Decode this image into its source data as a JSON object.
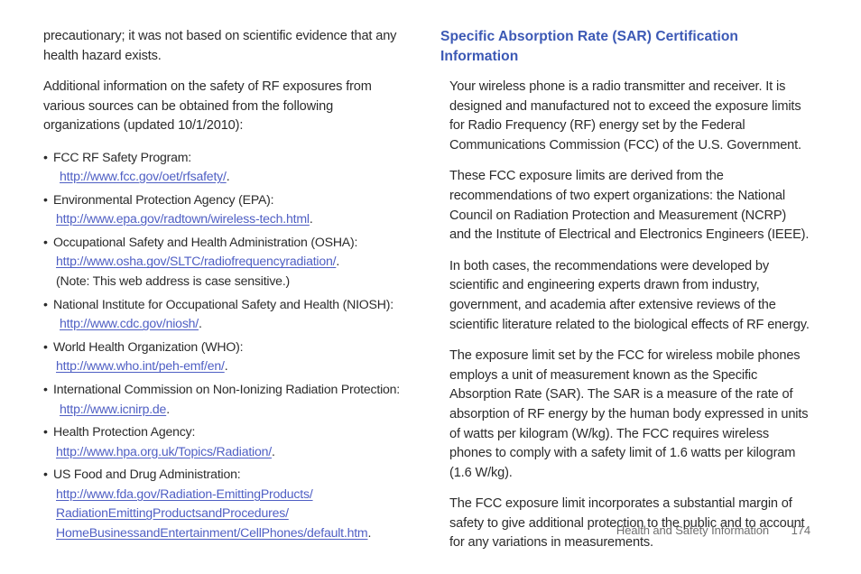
{
  "document": {
    "left_column": {
      "paragraphs": [
        "precautionary; it was not based on scientific evidence that any health hazard exists.",
        "Additional information on the safety of RF exposures from various sources can be obtained from the following organizations (updated 10/1/2010):"
      ],
      "bullet_marker": "•",
      "organizations": [
        {
          "label": "FCC RF Safety Program:",
          "url": "http://www.fcc.gov/oet/rfsafety/",
          "url_extra_indent": true,
          "note": ""
        },
        {
          "label": "Environmental Protection Agency (EPA):",
          "url": "http://www.epa.gov/radtown/wireless-tech.html",
          "url_extra_indent": false,
          "note": ""
        },
        {
          "label": "Occupational Safety and Health Administration (OSHA):",
          "url": "http://www.osha.gov/SLTC/radiofrequencyradiation/",
          "url_extra_indent": false,
          "note": "(Note: This web address is case sensitive.)"
        },
        {
          "label": "National Institute for Occupational Safety and Health (NIOSH):",
          "url": "http://www.cdc.gov/niosh/",
          "url_extra_indent": true,
          "note": ""
        },
        {
          "label": "World Health Organization (WHO):",
          "url": "http://www.who.int/peh-emf/en/",
          "url_extra_indent": false,
          "note": ""
        },
        {
          "label": "International Commission on Non-Ionizing Radiation Protection:",
          "url": "http://www.icnirp.de",
          "url_extra_indent": true,
          "note": ""
        },
        {
          "label": "Health Protection Agency:",
          "url": "http://www.hpa.org.uk/Topics/Radiation/",
          "url_extra_indent": false,
          "note": ""
        }
      ],
      "fda_entry": {
        "label": "US Food and Drug Administration:",
        "url_lines": [
          "http://www.fda.gov/Radiation-EmittingProducts/",
          "RadiationEmittingProductsandProcedures/",
          "HomeBusinessandEntertainment/CellPhones/default.htm"
        ],
        "trailing_period": "."
      },
      "period": "."
    },
    "right_column": {
      "heading": "Specific Absorption Rate (SAR) Certification Information",
      "paragraphs": [
        "Your wireless phone is a radio transmitter and receiver. It is designed and manufactured not to exceed the exposure limits for Radio Frequency (RF) energy set by the Federal Communications Commission (FCC) of the U.S. Government.",
        "These FCC exposure limits are derived from the recommendations of two expert organizations: the National Council on Radiation Protection and Measurement (NCRP) and the Institute of Electrical and Electronics Engineers (IEEE).",
        "In both cases, the recommendations were developed by scientific and engineering experts drawn from industry, government, and academia after extensive reviews of the scientific literature related to the biological effects of RF energy.",
        "The exposure limit set by the FCC for wireless mobile phones employs a unit of measurement known as the Specific Absorption Rate (SAR). The SAR is a measure of the rate of absorption of RF energy by the human body expressed in units of watts per kilogram (W/kg). The FCC requires wireless phones to comply with a safety limit of 1.6 watts per kilogram (1.6 W/kg).",
        "The FCC exposure limit incorporates a substantial margin of safety to give additional protection to the public and to account for any variations in measurements."
      ]
    },
    "footer": {
      "label": "Health and Safety Information",
      "page_number": "174"
    },
    "colors": {
      "heading_blue": "#3c59b5",
      "link_blue": "#4f5fc4",
      "body_text": "#2b2b2b",
      "footer_gray": "#6e6e6e"
    }
  }
}
